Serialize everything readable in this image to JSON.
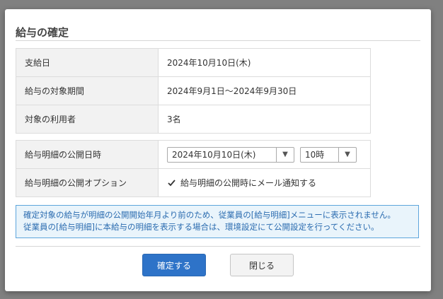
{
  "dialog": {
    "title": "給与の確定",
    "rows": [
      {
        "label": "支給日",
        "value": "2024年10月10日(木)"
      },
      {
        "label": "給与の対象期間",
        "value": "2024年9月1日～2024年9月30日"
      },
      {
        "label": "対象の利用者",
        "value": "3名"
      }
    ],
    "publish": {
      "datetime_label": "給与明細の公開日時",
      "date_value": "2024年10月10日(木)",
      "hour_value": "10時",
      "option_label": "給与明細の公開オプション",
      "checkbox_label": "給与明細の公開時にメール通知する",
      "checkbox_checked": true
    },
    "notice": [
      "確定対象の給与が明細の公開開始年月より前のため、従業員の[給与明細]メニューに表示されません。",
      "従業員の[給与明細]に本給与の明細を表示する場合は、環境設定にて公開設定を行ってください。"
    ],
    "buttons": {
      "confirm": "確定する",
      "close": "閉じる"
    }
  }
}
